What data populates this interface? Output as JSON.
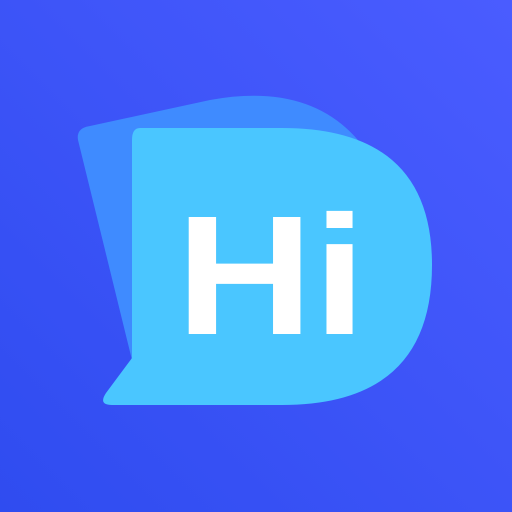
{
  "app_icon": {
    "label": "Hi",
    "icon_name": "speech-bubble-icon",
    "colors": {
      "background_start": "#2f4cf0",
      "background_end": "#4a5cff",
      "back_bubble": "#3f8bff",
      "front_bubble": "#4ac6ff",
      "text": "#ffffff"
    }
  }
}
